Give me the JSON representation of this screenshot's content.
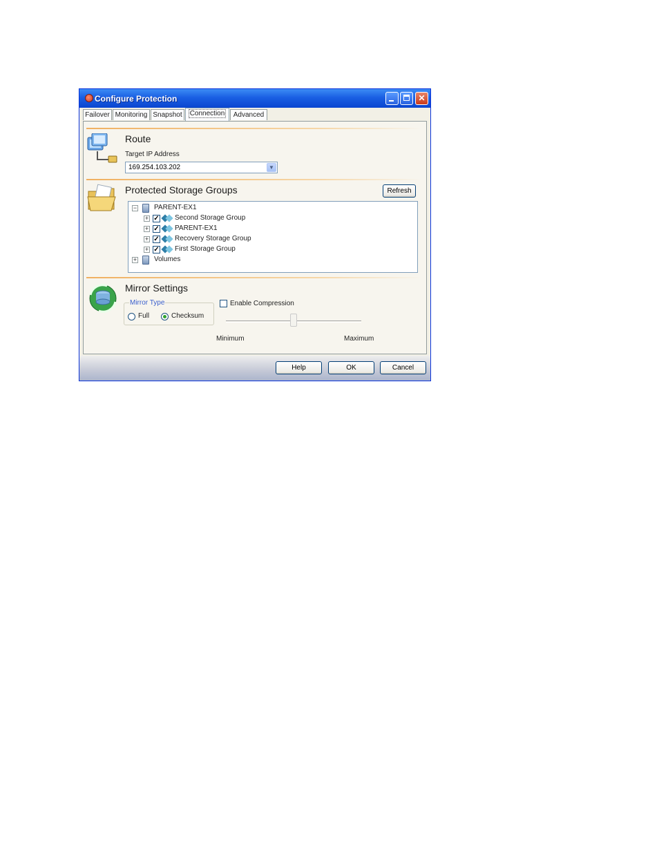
{
  "window": {
    "title": "Configure Protection"
  },
  "tabs": [
    {
      "label": "Failover"
    },
    {
      "label": "Monitoring"
    },
    {
      "label": "Snapshot"
    },
    {
      "label": "Connection",
      "active": true
    },
    {
      "label": "Advanced"
    }
  ],
  "route": {
    "heading": "Route",
    "target_ip_label": "Target IP Address",
    "target_ip_value": "169.254.103.202"
  },
  "storage_groups": {
    "heading": "Protected Storage Groups",
    "refresh_label": "Refresh",
    "tree": {
      "root": "PARENT-EX1",
      "children": [
        {
          "label": "Second Storage Group",
          "checked": true
        },
        {
          "label": "PARENT-EX1",
          "checked": true
        },
        {
          "label": "Recovery Storage Group",
          "checked": true
        },
        {
          "label": "First Storage Group",
          "checked": true
        }
      ],
      "volumes": "Volumes"
    }
  },
  "mirror": {
    "heading": "Mirror Settings",
    "type_label": "Mirror Type",
    "options": [
      {
        "label": "Full",
        "selected": false
      },
      {
        "label": "Checksum",
        "selected": true
      }
    ],
    "compression_label": "Enable Compression",
    "compression_checked": false,
    "slider_min_label": "Minimum",
    "slider_max_label": "Maximum"
  },
  "buttons": {
    "help": "Help",
    "ok": "OK",
    "cancel": "Cancel"
  },
  "colors": {
    "titlebar": "#0a46d0",
    "accent_separator": "#f0b060",
    "label_blue": "#3a5fcd"
  }
}
